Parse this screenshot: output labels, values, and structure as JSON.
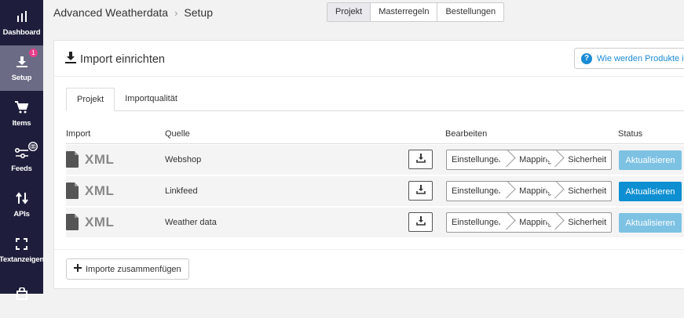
{
  "sidebar": {
    "items": [
      {
        "label": "Dashboard",
        "icon": "bar-chart-icon",
        "active": false
      },
      {
        "label": "Setup",
        "icon": "download-icon",
        "active": true,
        "badge": "1"
      },
      {
        "label": "Items",
        "icon": "cart-icon",
        "active": false
      },
      {
        "label": "Feeds",
        "icon": "feeds-icon",
        "active": false
      },
      {
        "label": "APIs",
        "icon": "swap-vertical-icon",
        "active": false
      },
      {
        "label": "Textanzeigen",
        "icon": "focus-frame-icon",
        "active": false
      },
      {
        "label": "",
        "icon": "bag-icon",
        "active": false
      }
    ]
  },
  "header": {
    "breadcrumb_app": "Advanced Weatherdata",
    "breadcrumb_page": "Setup",
    "tabs": [
      "Projekt",
      "Masterregeln",
      "Bestellungen"
    ]
  },
  "card": {
    "title": "Import einrichten",
    "help_label": "Wie werden Produkte importiert?",
    "subtabs": [
      "Projekt",
      "Importqualität"
    ],
    "columns": {
      "import": "Import",
      "source": "Quelle",
      "edit": "Bearbeiten",
      "status": "Status"
    },
    "rows": [
      {
        "type": "XML",
        "source": "Webshop",
        "steps": [
          "Einstellungen",
          "Mapping",
          "Sicherheit"
        ],
        "action": "Aktualisieren",
        "action_enabled": false
      },
      {
        "type": "XML",
        "source": "Linkfeed",
        "steps": [
          "Einstellungen",
          "Mapping",
          "Sicherheit"
        ],
        "action": "Aktualisieren",
        "action_enabled": true
      },
      {
        "type": "XML",
        "source": "Weather data",
        "steps": [
          "Einstellungen",
          "Mapping",
          "Sicherheit"
        ],
        "action": "Aktualisieren",
        "action_enabled": false
      }
    ],
    "merge_label": "Importe zusammenfügen"
  },
  "colors": {
    "sidebar_bg": "#1e1e3c",
    "accent": "#1a8bd4",
    "button_active": "#0d8fd1",
    "button_disabled": "#7dc2e3",
    "badge": "#e83e8c"
  }
}
